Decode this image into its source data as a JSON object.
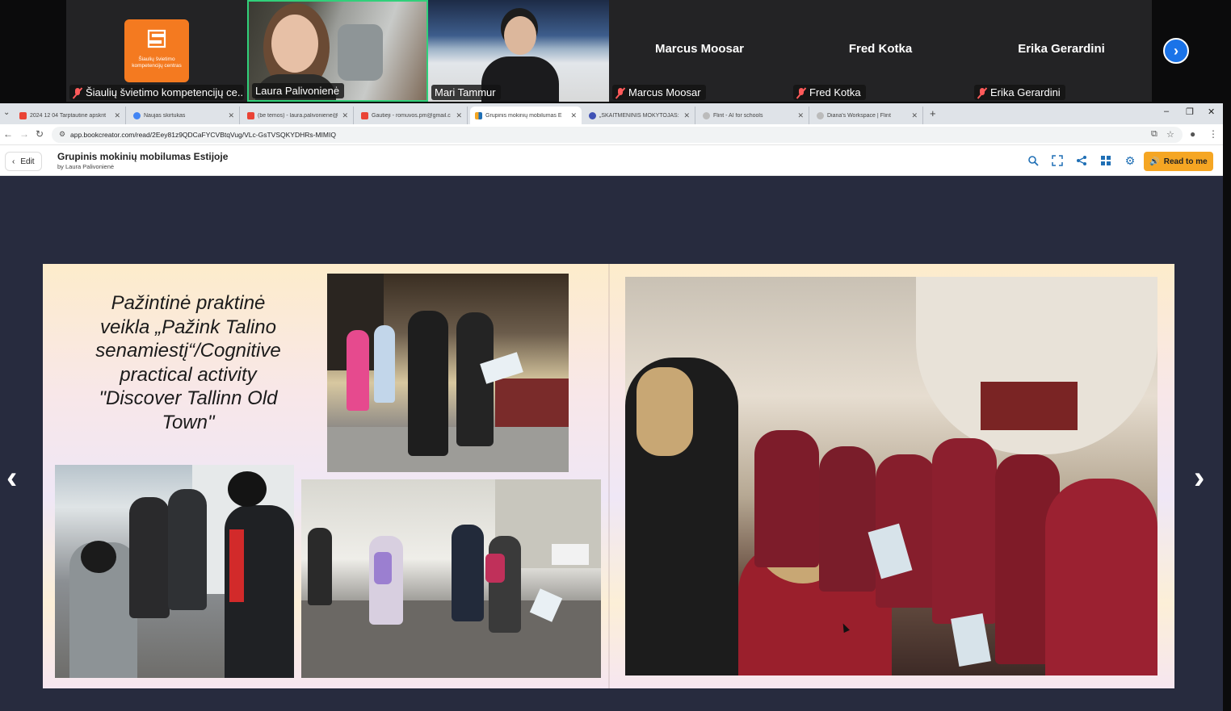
{
  "meeting": {
    "participants": [
      {
        "name": "Šiaulių švietimo kompetencijų ce...",
        "logo_text": "Šiaulių švietimo kompetencijų centras",
        "muted": true
      },
      {
        "name": "Laura Palivonienė",
        "muted": false,
        "speaking": true
      },
      {
        "name": "Mari Tammur",
        "muted": false
      },
      {
        "name": "Marcus Moosar",
        "display_name": "Marcus Moosar",
        "muted": true
      },
      {
        "name": "Fred Kotka",
        "display_name": "Fred Kotka",
        "muted": true
      },
      {
        "name": "Erika Gerardini",
        "display_name": "Erika Gerardini",
        "muted": true
      }
    ],
    "next_icon": "chevron-right-icon",
    "speaking_color": "#31d07a",
    "logo_color": "#f47a20"
  },
  "browser": {
    "tabs": [
      {
        "label": "2024 12 04 Tarptautinė apskrit",
        "icon": "gmail-icon",
        "active": false
      },
      {
        "label": "Naujas skirtukas",
        "icon": "chrome-icon",
        "active": false
      },
      {
        "label": "(be temos) - laura.palivoniene@",
        "icon": "gmail-icon",
        "active": false
      },
      {
        "label": "Gautieji - romuvos.pm@gmail.c",
        "icon": "gmail-icon",
        "active": false
      },
      {
        "label": "Grupinis mokinių mobilumas E",
        "icon": "bookcreator-icon",
        "active": true
      },
      {
        "label": "„SKAITMENINIS MOKYTOJAS: A",
        "icon": "site-icon",
        "active": false
      },
      {
        "label": "Flint - AI for schools",
        "icon": "flint-icon",
        "active": false
      },
      {
        "label": "Diana's Workspace | Flint",
        "icon": "flint-icon",
        "active": false
      }
    ],
    "url": "app.bookcreator.com/read/2Eey81z9QDCaFYCVBtqVug/VLc-GsTVSQKYDHRs-MIMIQ"
  },
  "app": {
    "edit_label": "Edit",
    "book_title": "Grupinis mokinių mobilumas Estijoje",
    "book_author": "by Laura Palivonienė",
    "read_to_me_label": "Read to me",
    "toolbar_icons": [
      "zoom-icon",
      "fullscreen-icon",
      "share-icon",
      "grid-icon",
      "settings-icon"
    ],
    "accent_color": "#f5a623",
    "toolbar_color": "#1f6fb5"
  },
  "page": {
    "caption_lines": [
      "Pažintinė praktinė",
      "veikla „Pažink Talino",
      "senamiestį“/Cognitive",
      "practical activity",
      "\"Discover Tallinn Old",
      "Town\""
    ]
  }
}
